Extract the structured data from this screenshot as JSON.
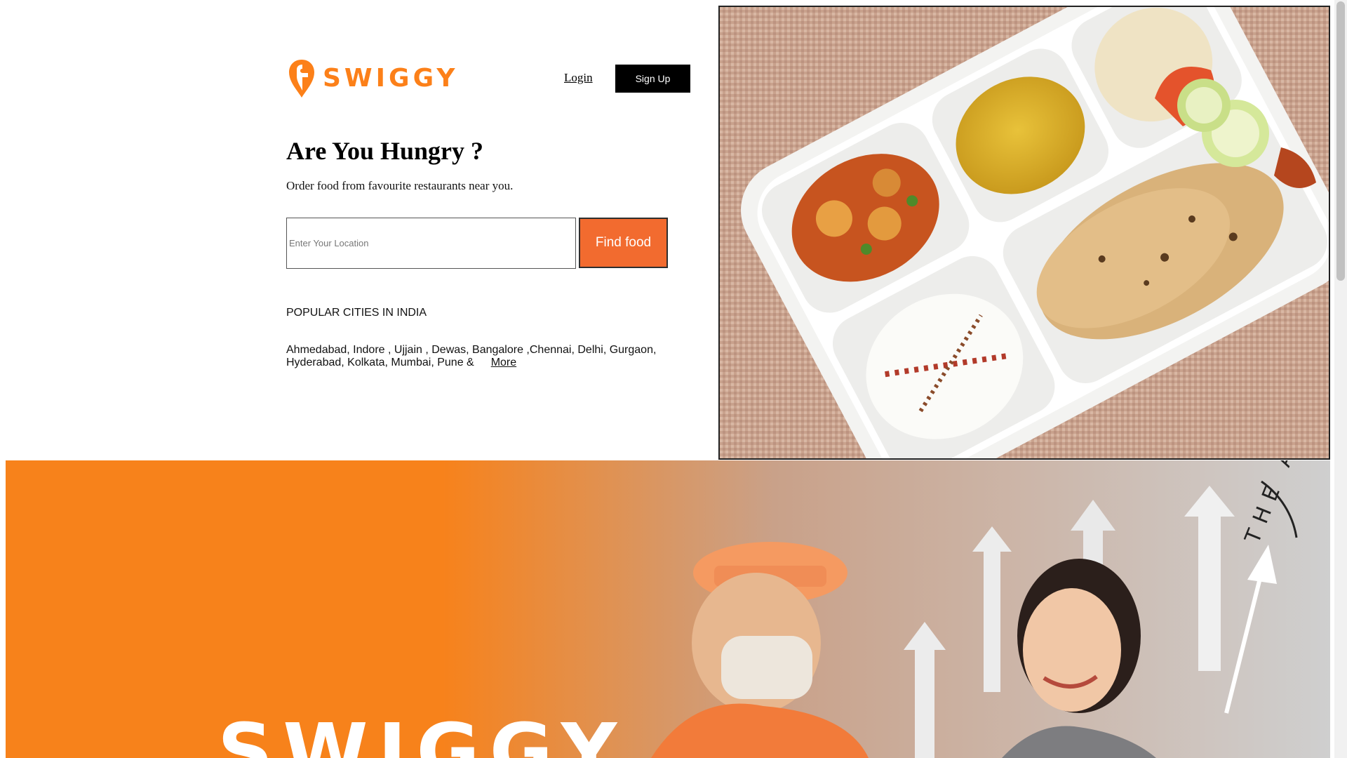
{
  "brand": {
    "name": "SWIGGY",
    "color": "#fc8019"
  },
  "header": {
    "login_label": "Login",
    "signup_label": "Sign Up"
  },
  "hero": {
    "headline": "Are You Hungry ?",
    "subline": "Order food from favourite restaurants near you.",
    "location_placeholder": "Enter Your Location",
    "find_button_label": "Find food",
    "find_button_color": "#f26b2f"
  },
  "popular_cities": {
    "heading": "POPULAR CITIES IN INDIA",
    "list_text": "Ahmedabad, Indore , Ujjain , Dewas, Bangalore ,Chennai, Delhi, Gurgaon, Hyderabad, Kolkata, Mumbai, Pune &",
    "more_label": "More"
  },
  "promo": {
    "brand_word": "SWIGGY",
    "arc_text": "THE ARC",
    "background_color": "#f7821b"
  }
}
